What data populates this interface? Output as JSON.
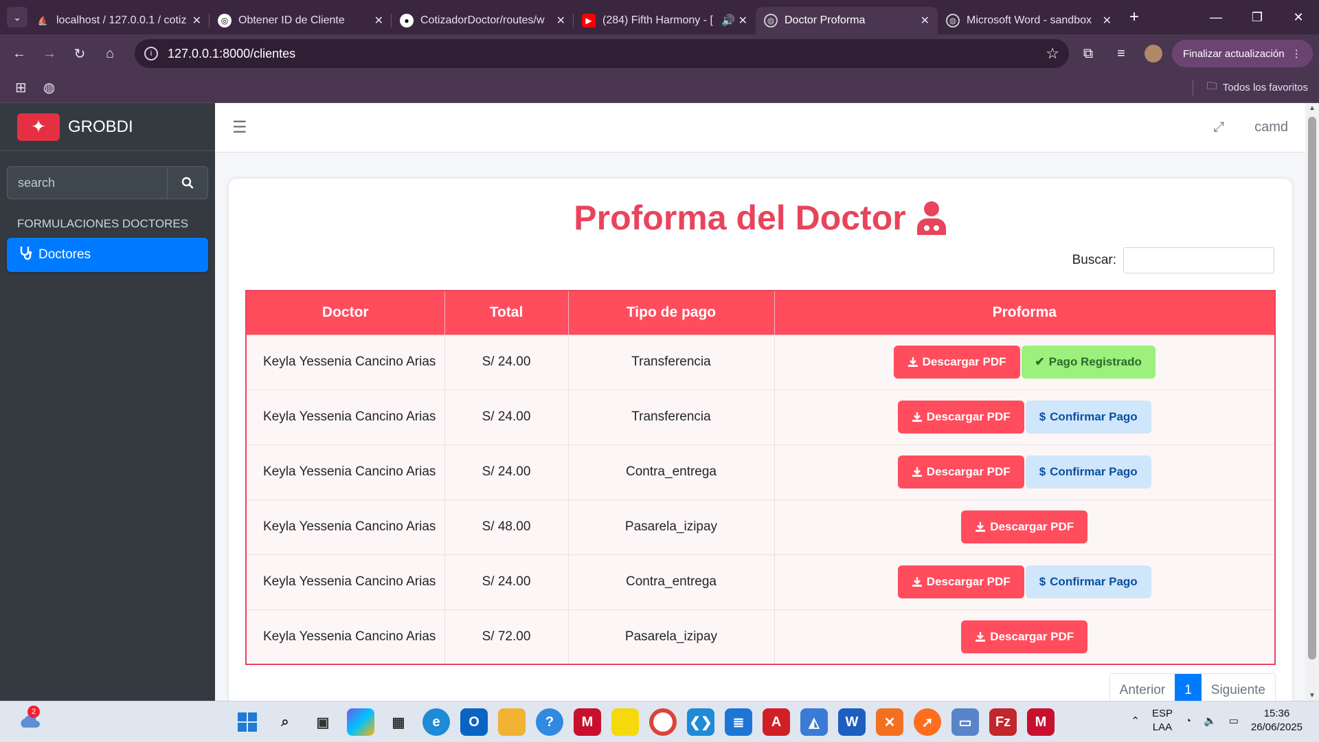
{
  "browser": {
    "tabs": [
      {
        "label": "localhost / 127.0.0.1 / cotiz",
        "active": false
      },
      {
        "label": "Obtener ID de Cliente",
        "active": false
      },
      {
        "label": "CotizadorDoctor/routes/w",
        "active": false
      },
      {
        "label": "(284) Fifth Harmony - [",
        "active": false
      },
      {
        "label": "Doctor Proforma",
        "active": true
      },
      {
        "label": "Microsoft Word - sandbox",
        "active": false
      }
    ],
    "url": "127.0.0.1:8000/clientes",
    "update_label": "Finalizar actualización",
    "bookmarks_label": "Todos los favoritos"
  },
  "sidebar": {
    "brand": "GROBDI",
    "search_placeholder": "search",
    "section_header": "FORMULACIONES DOCTORES",
    "active_item": "Doctores"
  },
  "topnav": {
    "user": "camd"
  },
  "page": {
    "title": "Proforma del Doctor",
    "search_label": "Buscar:",
    "columns": [
      "Doctor",
      "Total",
      "Tipo de pago",
      "Proforma"
    ],
    "rows": [
      {
        "doctor": "Keyla Yessenia Cancino Arias",
        "total": "S/ 24.00",
        "tipo": "Transferencia",
        "status": "registered"
      },
      {
        "doctor": "Keyla Yessenia Cancino Arias",
        "total": "S/ 24.00",
        "tipo": "Transferencia",
        "status": "pending"
      },
      {
        "doctor": "Keyla Yessenia Cancino Arias",
        "total": "S/ 24.00",
        "tipo": "Contra_entrega",
        "status": "pending"
      },
      {
        "doctor": "Keyla Yessenia Cancino Arias",
        "total": "S/ 48.00",
        "tipo": "Pasarela_izipay",
        "status": "none"
      },
      {
        "doctor": "Keyla Yessenia Cancino Arias",
        "total": "S/ 24.00",
        "tipo": "Contra_entrega",
        "status": "pending"
      },
      {
        "doctor": "Keyla Yessenia Cancino Arias",
        "total": "S/ 72.00",
        "tipo": "Pasarela_izipay",
        "status": "none"
      }
    ],
    "btn_pdf": "Descargar PDF",
    "btn_registered": "Pago Registrado",
    "btn_confirm": "Confirmar Pago",
    "pagination": {
      "prev": "Anterior",
      "current": "1",
      "next": "Siguiente"
    }
  },
  "taskbar": {
    "notification_count": "2",
    "lang_top": "ESP",
    "lang_bottom": "LAA",
    "time": "15:36",
    "date": "26/06/2025"
  },
  "colors": {
    "primary_red": "#ff4d5e",
    "title_red": "#e8445c",
    "sidebar_bg": "#343a40",
    "active_blue": "#007bff"
  }
}
